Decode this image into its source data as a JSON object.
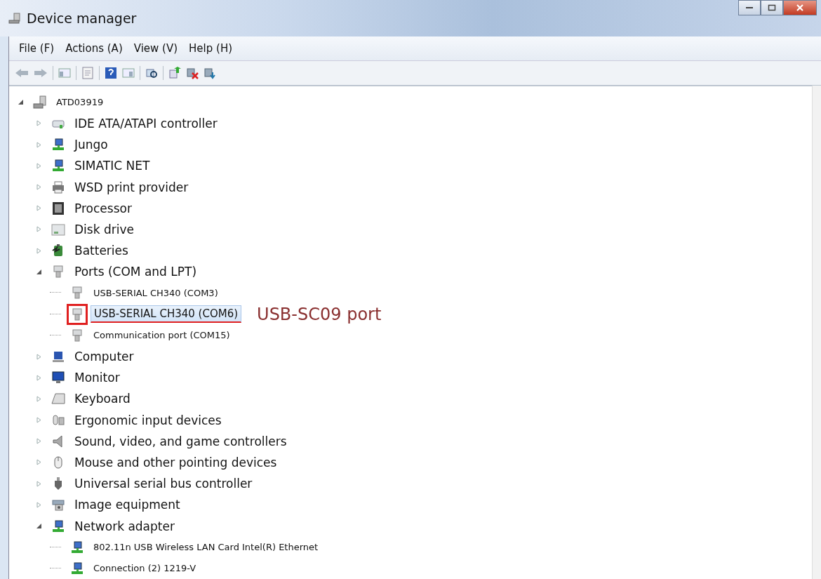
{
  "window": {
    "title": "Device manager"
  },
  "menu": [
    {
      "label": "File (F)"
    },
    {
      "label": "Actions (A)"
    },
    {
      "label": "View (V)"
    },
    {
      "label": "Help (H)"
    }
  ],
  "tree": [
    {
      "label": "ATD03919",
      "kind": "computer",
      "expanded": true,
      "selected": false,
      "children": [
        {
          "label": "IDE ATA/ATAPI controller",
          "kind": "controller",
          "expanded": false,
          "selected": false
        },
        {
          "label": "Jungo",
          "kind": "network",
          "expanded": false,
          "selected": false
        },
        {
          "label": "SIMATIC NET",
          "kind": "network",
          "expanded": false,
          "selected": false
        },
        {
          "label": "WSD print provider",
          "kind": "printer",
          "expanded": false,
          "selected": false
        },
        {
          "label": "Processor",
          "kind": "processor",
          "expanded": false,
          "selected": false
        },
        {
          "label": "Disk drive",
          "kind": "disk",
          "expanded": false,
          "selected": false
        },
        {
          "label": "Batteries",
          "kind": "battery",
          "expanded": false,
          "selected": false
        },
        {
          "label": "Ports (COM and LPT)",
          "kind": "port",
          "expanded": true,
          "selected": false,
          "children": [
            {
              "label": "USB-SERIAL CH340 (COM3)",
              "kind": "port",
              "selected": false
            },
            {
              "label": "USB-SERIAL CH340 (COM6)",
              "kind": "port",
              "selected": true,
              "note": "USB-SC09 port"
            },
            {
              "label": "Communication port (COM15)",
              "kind": "port",
              "selected": false
            }
          ]
        },
        {
          "label": "Computer",
          "kind": "pc",
          "expanded": false,
          "selected": false
        },
        {
          "label": "Monitor",
          "kind": "monitor",
          "expanded": false,
          "selected": false
        },
        {
          "label": "Keyboard",
          "kind": "keyboard",
          "expanded": false,
          "selected": false
        },
        {
          "label": "Ergonomic input devices",
          "kind": "hid",
          "expanded": false,
          "selected": false
        },
        {
          "label": "Sound, video, and game controllers",
          "kind": "sound",
          "expanded": false,
          "selected": false
        },
        {
          "label": "Mouse and other pointing devices",
          "kind": "mouse",
          "expanded": false,
          "selected": false
        },
        {
          "label": "Universal serial bus controller",
          "kind": "usb",
          "expanded": false,
          "selected": false
        },
        {
          "label": "Image equipment",
          "kind": "camera",
          "expanded": false,
          "selected": false
        },
        {
          "label": "Network adapter",
          "kind": "network",
          "expanded": true,
          "selected": false,
          "children": [
            {
              "label": "802.11n USB Wireless LAN Card Intel(R) Ethernet",
              "kind": "network",
              "selected": false
            },
            {
              "label": "Connection (2) 1219-V",
              "kind": "network",
              "selected": false
            }
          ]
        }
      ]
    }
  ]
}
